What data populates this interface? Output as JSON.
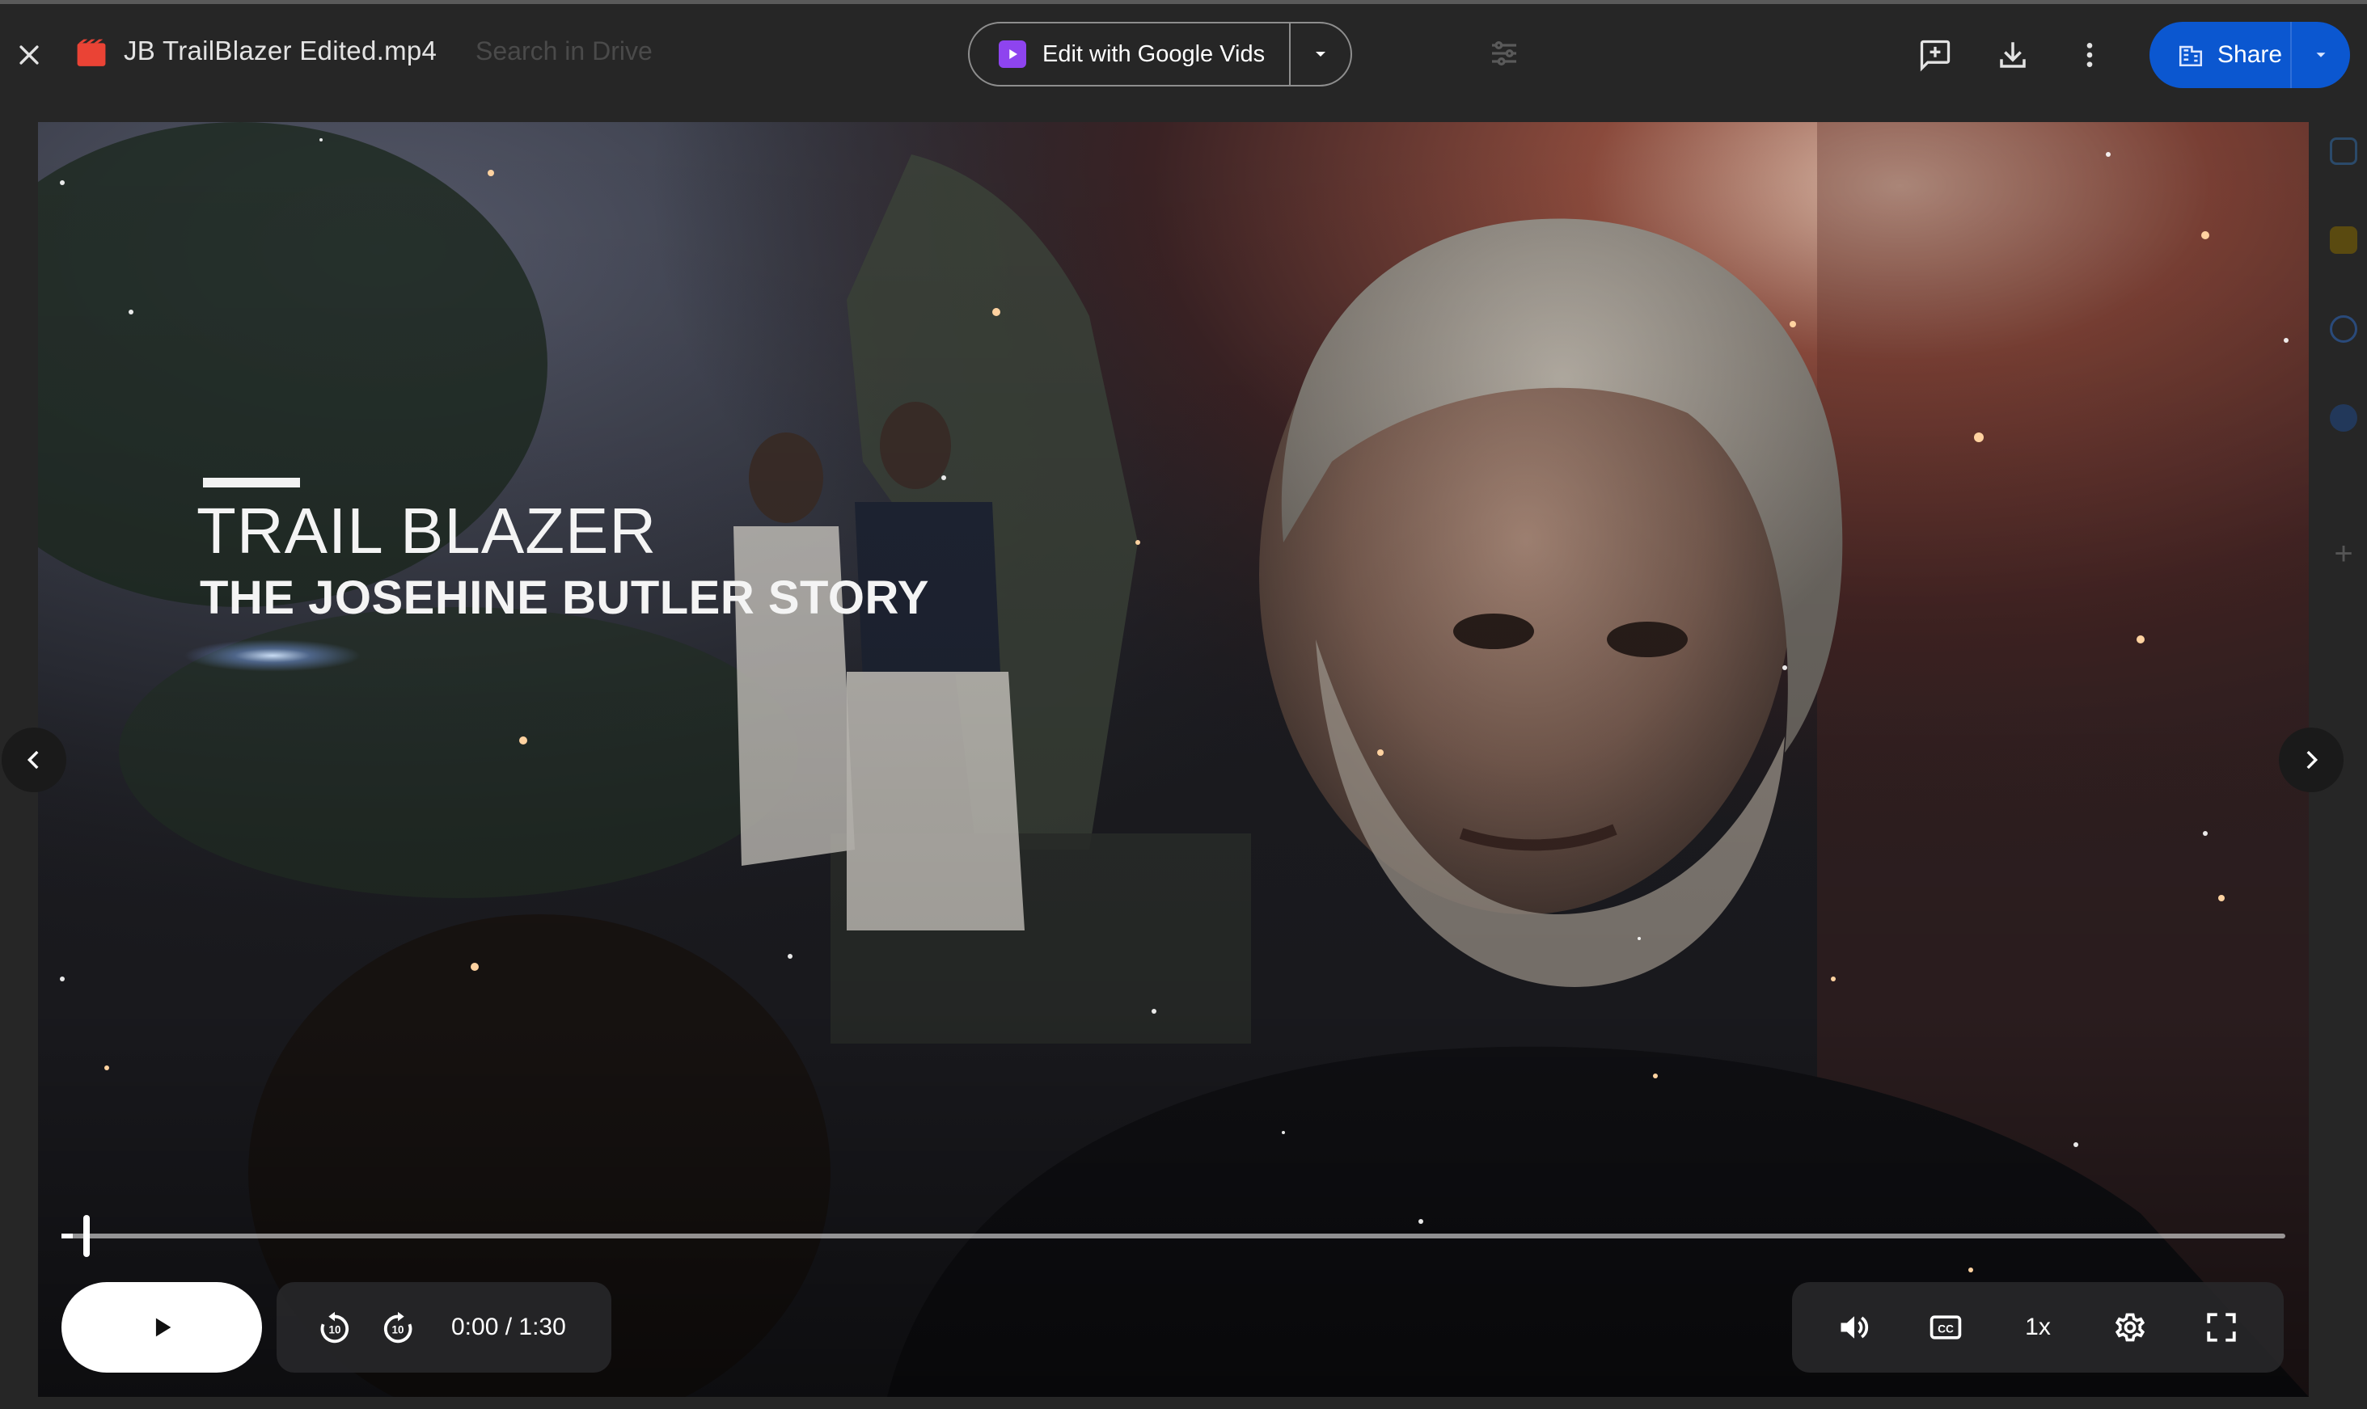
{
  "viewer": {
    "file_name": "JB TrailBlazer Edited.mp4",
    "edit_button_label": "Edit with Google Vids",
    "share_label": "Share"
  },
  "background": {
    "search_placeholder": "Search in Drive"
  },
  "video": {
    "title_line1": "TRAIL BLAZER",
    "title_line2": "THE JOSEHINE BUTLER STORY"
  },
  "player": {
    "current_time": "0:00",
    "duration": "1:30",
    "time_text": "0:00 / 1:30",
    "playback_speed": "1x",
    "progress": 0.0
  },
  "icons": {
    "close": "close-icon",
    "file_type": "video-file-icon",
    "vids": "google-vids-icon",
    "comment": "add-comment-icon",
    "download": "download-icon",
    "more": "more-vert-icon",
    "share": "share-building-icon",
    "play": "play-icon",
    "rewind": "replay-10-icon",
    "forward": "forward-10-icon",
    "volume": "volume-icon",
    "captions": "closed-captions-icon",
    "settings": "settings-gear-icon",
    "fullscreen": "fullscreen-icon",
    "prev": "chevron-left-icon",
    "next": "chevron-right-icon"
  },
  "colors": {
    "share_button": "#0b57d0",
    "vids_accent": "#8e44ef",
    "file_icon_red": "#ea4335"
  }
}
